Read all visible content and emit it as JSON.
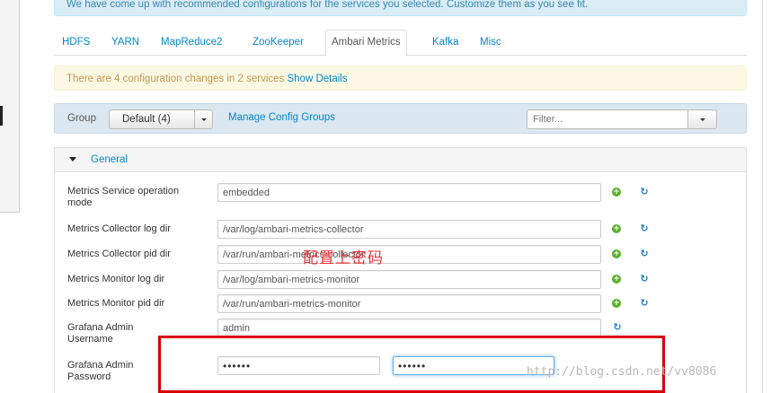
{
  "info_banner": "We have come up with recommended configurations for the services you selected. Customize them as you see fit.",
  "tabs": [
    {
      "label": "HDFS"
    },
    {
      "label": "YARN"
    },
    {
      "label": "MapReduce2"
    },
    {
      "label": "ZooKeeper"
    },
    {
      "label": "Ambari Metrics",
      "active": true
    },
    {
      "label": "Kafka"
    },
    {
      "label": "Misc"
    }
  ],
  "warning": {
    "text": "There are 4 configuration changes in 2 services ",
    "link": "Show Details"
  },
  "group_bar": {
    "label": "Group",
    "selected": "Default (4)",
    "manage_link": "Manage Config Groups",
    "filter_placeholder": "Filter..."
  },
  "section": {
    "title": "General"
  },
  "fields": {
    "operation_mode": {
      "label": "Metrics Service operation mode",
      "value": "embedded"
    },
    "collector_log_dir": {
      "label": "Metrics Collector log dir",
      "value": "/var/log/ambari-metrics-collector"
    },
    "collector_pid_dir": {
      "label": "Metrics Collector pid dir",
      "value": "/var/run/ambari-metrics-collector"
    },
    "monitor_log_dir": {
      "label": "Metrics Monitor log dir",
      "value": "/var/log/ambari-metrics-monitor"
    },
    "monitor_pid_dir": {
      "label": "Metrics Monitor pid dir",
      "value": "/var/run/ambari-metrics-monitor"
    },
    "grafana_username": {
      "label": "Grafana Admin Username",
      "value": "admin"
    },
    "grafana_password": {
      "label": "Grafana Admin Password",
      "value": "••••••",
      "confirm_value": "••••••"
    }
  },
  "annotation": "配置上密码",
  "watermark": "http://blog.csdn.net/vv8086",
  "colors": {
    "link": "#0088cc",
    "info_bg": "#d9edf7",
    "warning_bg": "#fcf8e3",
    "annotation_red": "#d90000"
  },
  "icons": {
    "add": "plus-circle-icon",
    "undo": "undo-icon",
    "caret": "caret-down-icon"
  }
}
